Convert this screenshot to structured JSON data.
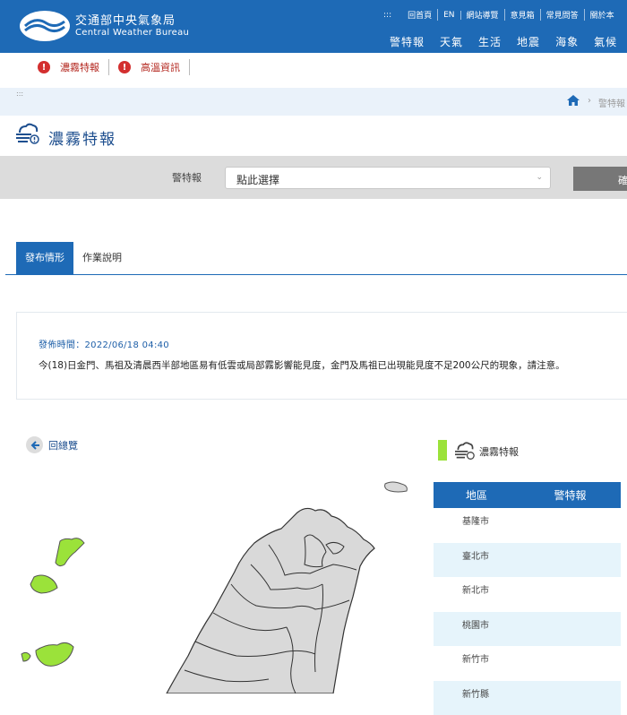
{
  "header": {
    "brand_cn": "交通部中央氣象局",
    "brand_en": "Central Weather Bureau",
    "top_dots": ":::",
    "top_links": [
      "回首頁",
      "EN",
      "網站導覽",
      "意見箱",
      "常見問答",
      "關於本"
    ],
    "main_nav": [
      "警特報",
      "天氣",
      "生活",
      "地震",
      "海象",
      "氣候"
    ],
    "bg_color": "#1e6ab6"
  },
  "alerts": [
    {
      "icon": "exclamation-icon",
      "label": "濃霧特報"
    },
    {
      "icon": "exclamation-icon",
      "label": "高溫資訊"
    }
  ],
  "breadcrumb": {
    "dots": ":::",
    "separator": "›",
    "current": "警特報"
  },
  "page": {
    "title": "濃霧特報",
    "title_icon": "fog-icon"
  },
  "filter": {
    "label": "警特報",
    "selected": "點此選擇",
    "confirm": "確"
  },
  "tabs": [
    {
      "label": "發布情形",
      "active": true
    },
    {
      "label": "作業說明",
      "active": false
    }
  ],
  "notice": {
    "time": "發佈時間：2022/06/18 04:40",
    "text": "今(18)日金門、馬祖及清晨西半部地區易有低雲或局部霧影響能見度，金門及馬祖已出現能見度不足200公尺的現象，請注意。"
  },
  "back_label": "回總覽",
  "legend": {
    "label": "濃霧特報",
    "color": "#9be23a"
  },
  "region_table": {
    "headers": [
      "地區",
      "警特報"
    ],
    "rows": [
      "基隆市",
      "臺北市",
      "新北市",
      "桃園市",
      "新竹市",
      "新竹縣"
    ]
  },
  "map": {
    "warning_color": "#9be23a",
    "base_color": "#d9d9d9"
  }
}
